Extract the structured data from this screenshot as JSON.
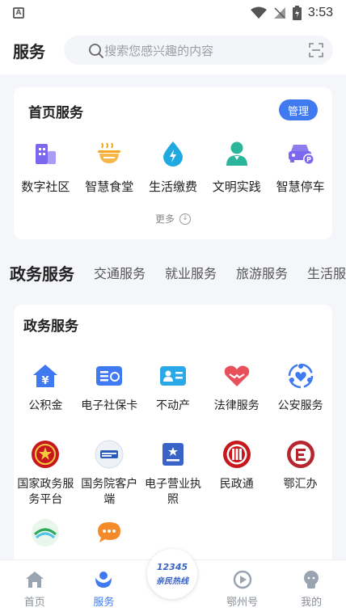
{
  "status_bar": {
    "time": "3:53"
  },
  "header": {
    "title": "服务",
    "search_placeholder": "搜索您感兴趣的内容"
  },
  "home_services": {
    "title": "首页服务",
    "manage_label": "管理",
    "items": [
      {
        "label": "数字社区",
        "icon": "building-icon"
      },
      {
        "label": "智慧食堂",
        "icon": "bowl-icon"
      },
      {
        "label": "生活缴费",
        "icon": "water-drop-icon"
      },
      {
        "label": "文明实践",
        "icon": "person-icon"
      },
      {
        "label": "智慧停车",
        "icon": "car-parking-icon"
      }
    ],
    "more_label": "更多"
  },
  "tabs": [
    {
      "label": "政务服务",
      "active": true
    },
    {
      "label": "交通服务"
    },
    {
      "label": "就业服务"
    },
    {
      "label": "旅游服务"
    },
    {
      "label": "生活服"
    }
  ],
  "gov_services": {
    "title": "政务服务",
    "items": [
      {
        "label": "公积金",
        "icon": "house-yuan-icon"
      },
      {
        "label": "电子社保卡",
        "icon": "card-icon"
      },
      {
        "label": "不动产",
        "icon": "id-card-icon"
      },
      {
        "label": "法律服务",
        "icon": "heart-hands-icon"
      },
      {
        "label": "公安服务",
        "icon": "police-badge-icon"
      },
      {
        "label": "国家政务服务平台",
        "icon": "national-emblem-icon"
      },
      {
        "label": "国务院客户端",
        "icon": "state-council-icon"
      },
      {
        "label": "电子营业执照",
        "icon": "license-icon"
      },
      {
        "label": "民政通",
        "icon": "civil-affairs-icon"
      },
      {
        "label": "鄂汇办",
        "icon": "ehuiban-icon"
      },
      {
        "label": "",
        "icon": "app-logo-icon"
      },
      {
        "label": "",
        "icon": "chat-bubble-icon"
      }
    ]
  },
  "bottom_nav": {
    "items": [
      {
        "label": "首页",
        "icon": "home-icon"
      },
      {
        "label": "服务",
        "icon": "service-icon",
        "active": true
      },
      {
        "label": "",
        "icon": "hotline-icon"
      },
      {
        "label": "鄂州号",
        "icon": "play-icon"
      },
      {
        "label": "我的",
        "icon": "profile-icon"
      }
    ],
    "hotline_number": "12345",
    "hotline_text": "亲民热线"
  },
  "colors": {
    "accent": "#3f7af0",
    "background": "#f4f6f9"
  }
}
